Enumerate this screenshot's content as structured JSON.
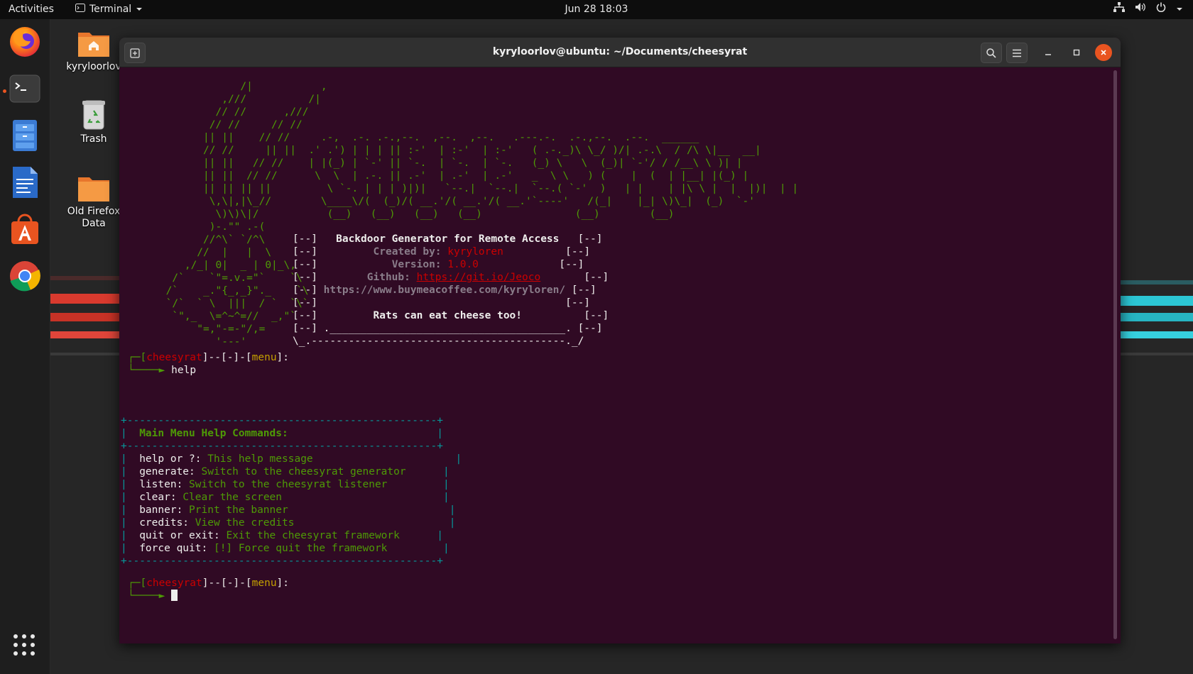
{
  "topbar": {
    "activities": "Activities",
    "app_name": "Terminal",
    "clock": "Jun 28  18:03"
  },
  "desktop": {
    "icons": [
      {
        "label": "kyryloorlov"
      },
      {
        "label": "Trash"
      },
      {
        "label": "Old Firefox Data"
      }
    ]
  },
  "window": {
    "title": "kyryloorlov@ubuntu: ~/Documents/cheesyrat"
  },
  "terminal": {
    "ascii_art": "                 /|           ,\n              ,///          /|\n             // //      ,///\n            // //     // //\n           || ||    // //     .-,  .-. .-.,--.  ,--.  ,--.   .---.-.  .-.,--.  .--.  ______\n           // //     || ||  .' .') | | | || :-'  | :-'  | :-'   ( .-._)\\ \\_/ )/| .-.\\  / /\\ \\|__  __|\n           || ||   // //    | |(_) | `-' || `-.  | `-.  | `-.   (_) \\   \\  (_)| `-'/ / /__\\ \\ )| |\n           || ||  // //      \\  \\  | .-. || .-'  | .-'  | .-'   _  \\ \\   ) (    |  (  | |__| |(_) |\n           || || || ||         \\ `-. | | | )|)|   `--.|  `--.|  `--.( `-'  )   | |    | |\\ \\ |  |  |)|  | |\n            \\,\\|,|\\_//        \\____\\/(  (_)/( __.'/( __.'/( __.'`----'   /(_|    |_| \\)\\_|  (_)  `-'\n             \\)\\)\\|/           (__)   (__)   (__)   (__)               (__)        (__)\n            )-.\"\" .-(\n           //^\\` `/^\\\n          //  |   |  \\\n        ,/_| 0|  _ | 0|_\\,\n      /`    `\"=.v.=\"`    `\\\n     /`    _.\"{_,_}\"._    `\\\n     `/`  ` \\  |||  / `  `\\`\n      `\",_  \\=^~^=//  _,\"`\n          \"=,\"-=-\"/,=\n             '---'",
    "banner": {
      "line1": "Backdoor Generator for Remote Access",
      "created_label": "Created by:",
      "created_value": "kyryloren",
      "version_label": "Version:",
      "version_value": "1.0.0",
      "github_label": "Github:",
      "github_value": "https://git.io/Jeoco",
      "coffee": "https://www.buymeacoffee.com/kyryloren/",
      "tagline": "Rats can eat cheese too!"
    },
    "prompt": {
      "name": "cheesyrat",
      "mid": "]--[-]-[",
      "menu": "menu",
      "end": "]:"
    },
    "typed_command": "help",
    "help": {
      "heading": "Main Menu Help Commands:",
      "commands": [
        {
          "cmd": "help or ?:",
          "desc": "This help message"
        },
        {
          "cmd": "generate:",
          "desc": "Switch to the cheesyrat generator"
        },
        {
          "cmd": "listen:",
          "desc": "Switch to the cheesyrat listener"
        },
        {
          "cmd": "clear:",
          "desc": "Clear the screen"
        },
        {
          "cmd": "banner:",
          "desc": "Print the banner"
        },
        {
          "cmd": "credits:",
          "desc": "View the credits"
        },
        {
          "cmd": "quit or exit:",
          "desc": "Exit the cheesyrat framework"
        },
        {
          "cmd": "force quit:",
          "desc": "[!] Force quit the framework"
        }
      ]
    }
  },
  "dock": {
    "items": [
      "firefox-icon",
      "terminal-icon",
      "files-icon",
      "writer-icon",
      "software-icon",
      "chrome-icon",
      "show-apps-icon"
    ]
  },
  "colors": {
    "terminal_bg": "#300a24",
    "accent": "#e95420",
    "green": "#4e9a06",
    "red": "#cc0000",
    "yellow": "#c4a000",
    "cyan": "#06989a"
  }
}
